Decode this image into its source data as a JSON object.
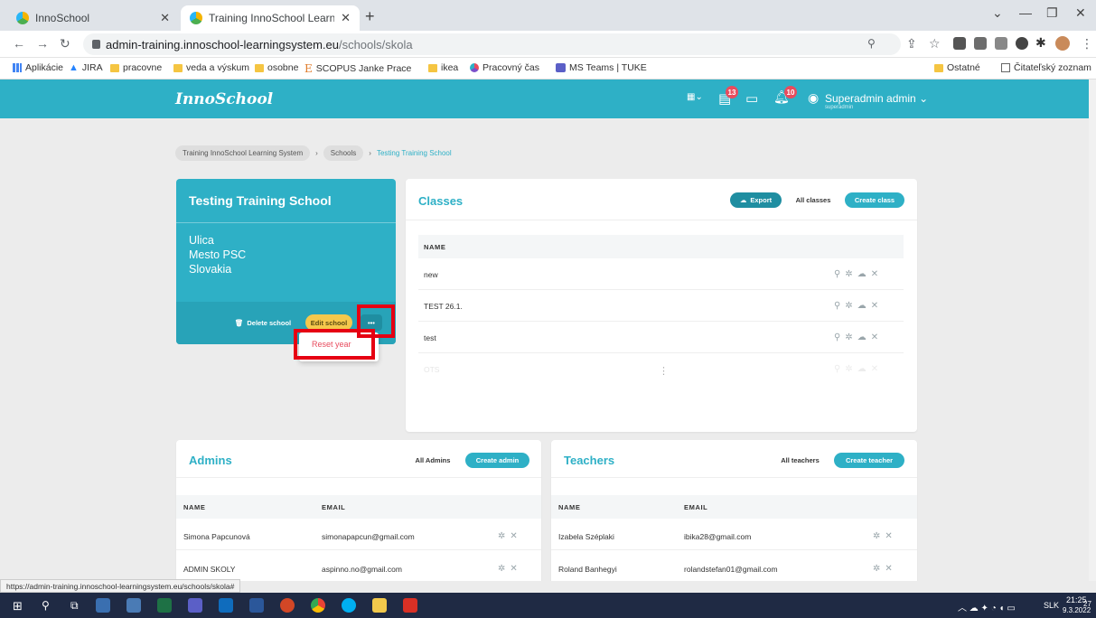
{
  "browser": {
    "tab1_title": "InnoSchool",
    "tab2_title": "Training InnoSchool Learning Sy:",
    "url_host": "admin-training.innoschool-learningsystem.eu",
    "url_path": "/schools/skola",
    "bookmarks": [
      "Aplikácie",
      "JIRA",
      "pracovne",
      "veda a výskum",
      "osobne",
      "SCOPUS Janke Prace",
      "ikea",
      "Pracovný čas",
      "MS Teams | TUKE"
    ],
    "bookmarks_right": [
      "Ostatné",
      "Čitateľský zoznam"
    ],
    "status_url": "https://admin-training.innoschool-learningsystem.eu/schools/skola#"
  },
  "app": {
    "logo": "InnoSchool",
    "badge_a": "13",
    "badge_b": "10",
    "user_name": "Superadmin admin",
    "user_role": "superadmin"
  },
  "breadcrumb": {
    "item1": "Training InnoSchool Learning System",
    "item2": "Schools",
    "current": "Testing Training School",
    "sep": "›"
  },
  "school": {
    "name": "Testing Training School",
    "street": "Ulica",
    "city": "Mesto PSC",
    "country": "Slovakia",
    "delete_label": "Delete school",
    "edit_label": "Edit school",
    "more_label": "•••",
    "menu_item": "Reset year"
  },
  "classes": {
    "title": "Classes",
    "export_label": "Export",
    "all_label": "All classes",
    "create_label": "Create class",
    "col_name": "NAME",
    "rows": [
      "new",
      "TEST 26.1.",
      "test",
      "OTS"
    ]
  },
  "admins": {
    "title": "Admins",
    "all_label": "All Admins",
    "create_label": "Create admin",
    "col_name": "NAME",
    "col_email": "EMAIL",
    "rows": [
      {
        "name": "Simona Papcunová",
        "email": "simonapapcun@gmail.com"
      },
      {
        "name": "ADMIN SKOLY",
        "email": "aspinno.no@gmail.com"
      }
    ]
  },
  "teachers": {
    "title": "Teachers",
    "all_label": "All teachers",
    "create_label": "Create teacher",
    "col_name": "NAME",
    "col_email": "EMAIL",
    "rows": [
      {
        "name": "Izabela Széplaki",
        "email": "ibika28@gmail.com"
      },
      {
        "name": "Roland Banhegyi",
        "email": "rolandstefan01@gmail.com"
      }
    ]
  },
  "taskbar": {
    "lang": "SLK",
    "time": "21:25",
    "date": "9.3.2022",
    "notif": "27"
  },
  "colors": {
    "accent": "#2eb0c6",
    "danger": "#e84c5e",
    "highlight": "#e60012",
    "edit_button": "#f5c84c"
  }
}
